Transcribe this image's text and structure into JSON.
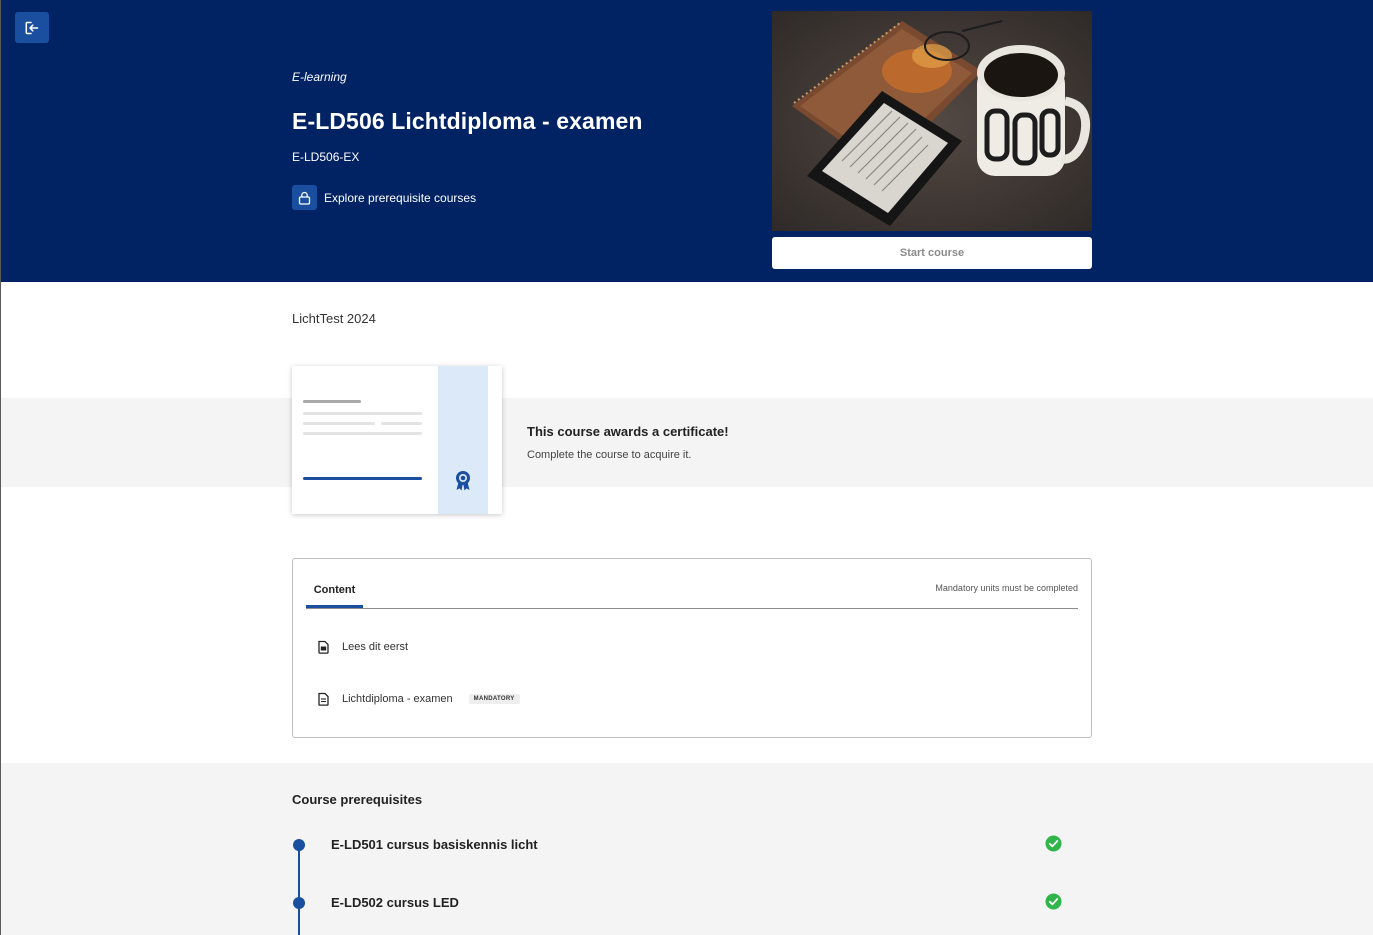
{
  "header": {
    "type_label": "E-learning",
    "title": "E-LD506 Lichtdiploma - examen",
    "code": "E-LD506-EX",
    "prerequisites_link": "Explore prerequisite courses",
    "start_button": "Start course"
  },
  "catalog_name": "LichtTest 2024",
  "certificate": {
    "title": "This course awards a certificate!",
    "subtitle": "Complete the course to acquire it."
  },
  "content": {
    "tab_label": "Content",
    "note": "Mandatory units must be completed",
    "units": [
      {
        "title": "Lees dit eerst",
        "icon": "document-icon",
        "mandatory": false
      },
      {
        "title": "Lichtdiploma - examen",
        "icon": "document-icon",
        "mandatory": true,
        "badge": "MANDATORY"
      }
    ]
  },
  "prerequisites": {
    "heading": "Course prerequisites",
    "items": [
      {
        "title": "E-LD501 cursus basiskennis licht",
        "status": "completed"
      },
      {
        "title": "E-LD502 cursus LED",
        "status": "completed"
      }
    ]
  },
  "colors": {
    "header_bg": "#012263",
    "accent": "#1a4fa0",
    "success": "#2fb54a"
  }
}
